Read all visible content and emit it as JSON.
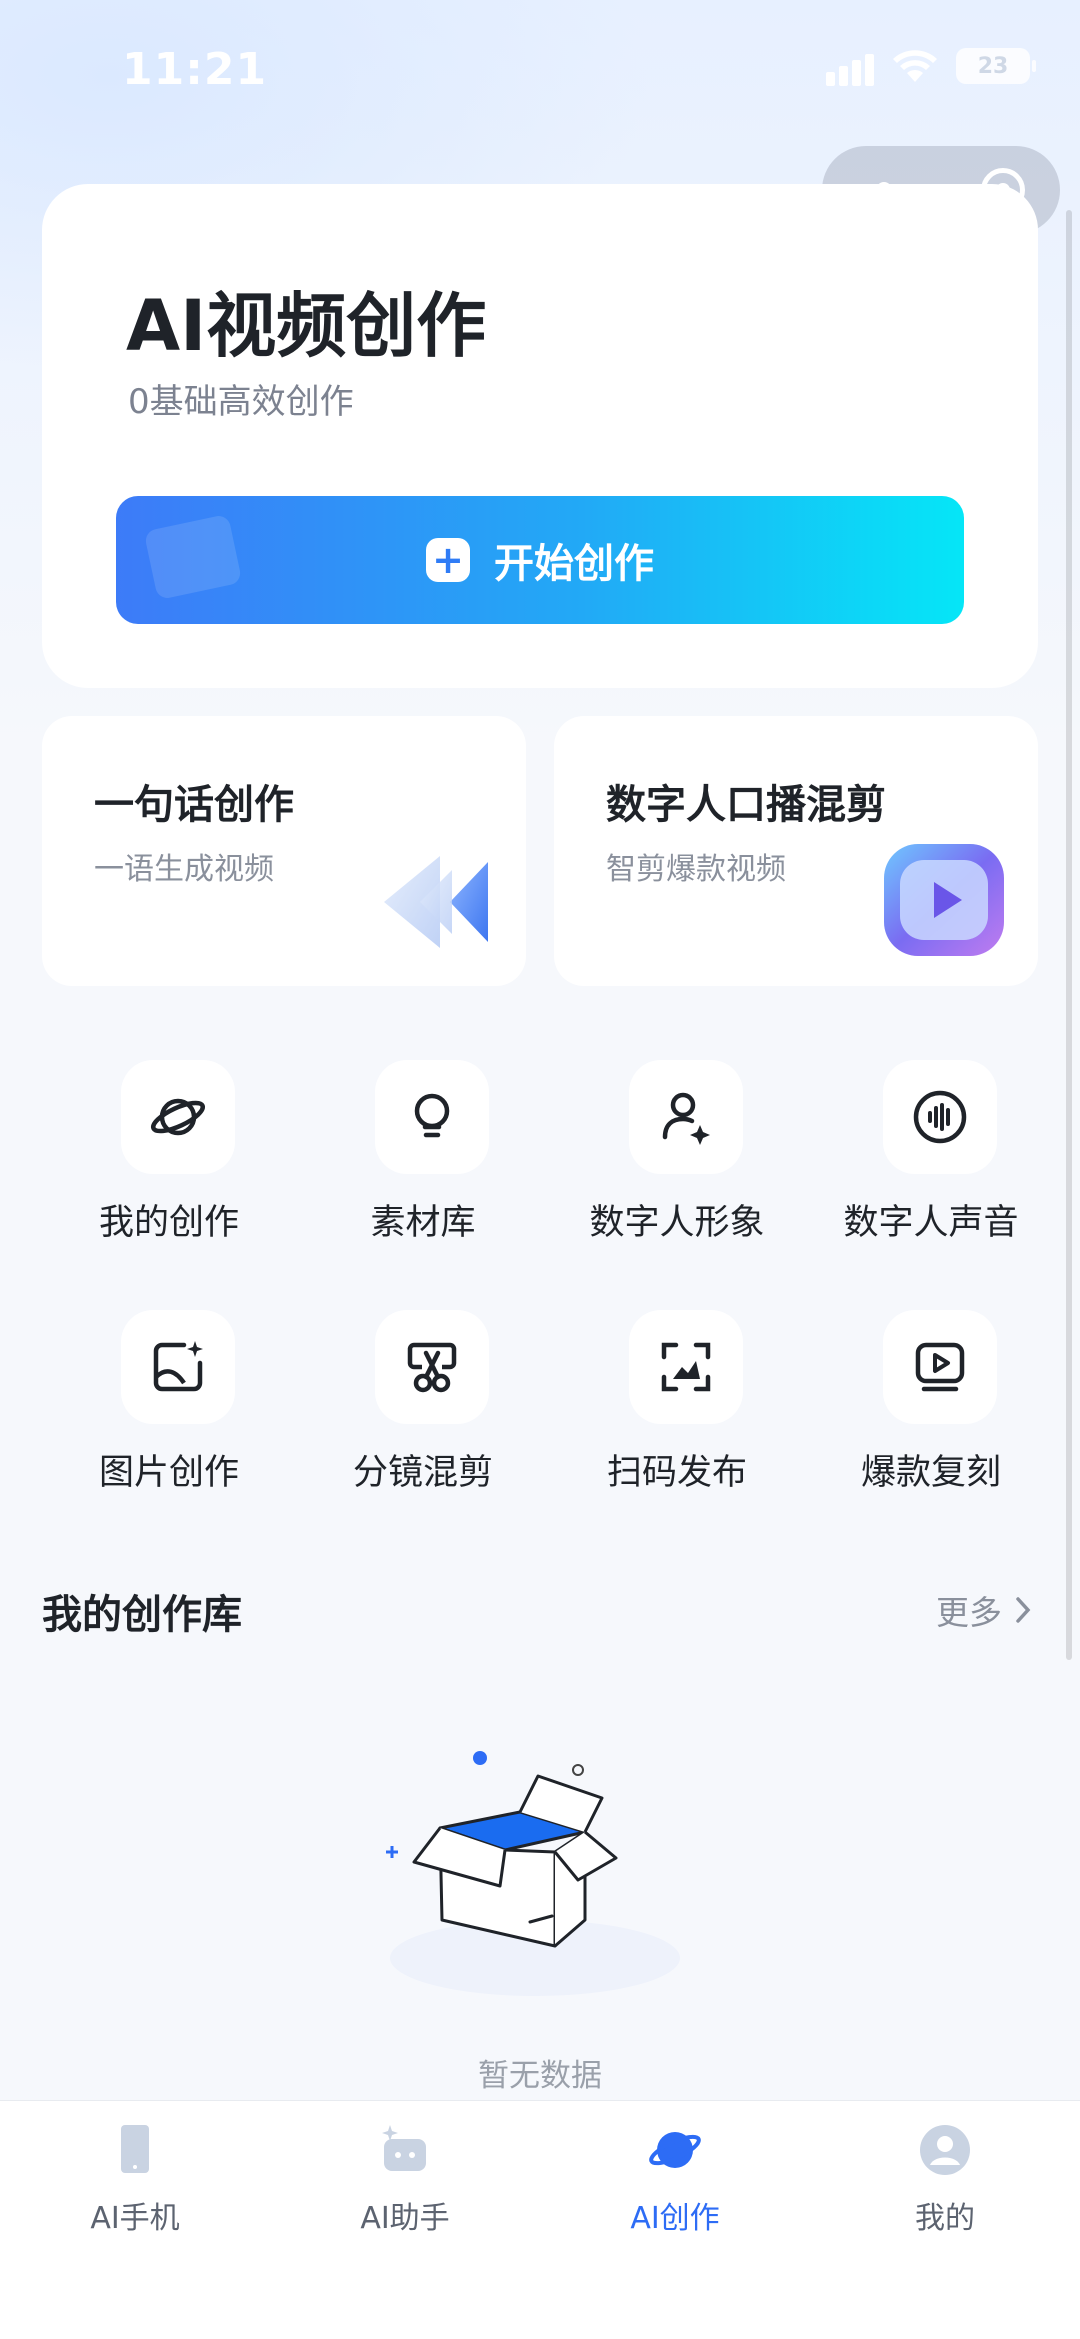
{
  "status": {
    "time": "11:21",
    "battery": "23"
  },
  "hero": {
    "title": "AI视频创作",
    "subtitle": "0基础高效创作",
    "button_label": "开始创作"
  },
  "features": [
    {
      "title": "一句话创作",
      "subtitle": "一语生成视频"
    },
    {
      "title": "数字人口播混剪",
      "subtitle": "智剪爆款视频"
    }
  ],
  "grid": [
    {
      "label": "我的创作",
      "icon": "planet-icon"
    },
    {
      "label": "素材库",
      "icon": "lightbulb-icon"
    },
    {
      "label": "数字人形象",
      "icon": "person-sparkle-icon"
    },
    {
      "label": "数字人声音",
      "icon": "voice-wave-icon"
    },
    {
      "label": "图片创作",
      "icon": "image-sparkle-icon"
    },
    {
      "label": "分镜混剪",
      "icon": "scissors-icon"
    },
    {
      "label": "扫码发布",
      "icon": "scan-icon"
    },
    {
      "label": "爆款复刻",
      "icon": "play-screen-icon"
    }
  ],
  "library": {
    "title": "我的创作库",
    "more": "更多",
    "empty": "暂无数据"
  },
  "tabs": [
    {
      "label": "AI手机",
      "icon": "phone-icon"
    },
    {
      "label": "AI助手",
      "icon": "robot-icon"
    },
    {
      "label": "AI创作",
      "icon": "planet-icon",
      "active": true
    },
    {
      "label": "我的",
      "icon": "profile-icon"
    }
  ],
  "colors": {
    "accent": "#2d6cf5",
    "gradient_start": "#3d7bf8",
    "gradient_end": "#05e6f7"
  }
}
